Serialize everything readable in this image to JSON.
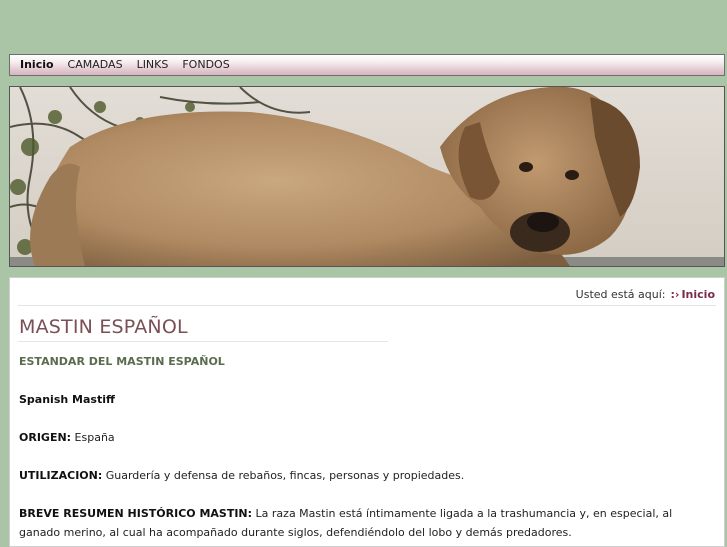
{
  "nav": {
    "items": [
      {
        "label": "Inicio",
        "active": true
      },
      {
        "label": "CAMADAS",
        "active": false
      },
      {
        "label": "LINKS",
        "active": false
      },
      {
        "label": "FONDOS",
        "active": false
      }
    ]
  },
  "banner": {
    "icon": "mastiff-puppy-photo"
  },
  "breadcrumb": {
    "prefix": "Usted está aquí:",
    "separator": ":›",
    "current": "Inicio"
  },
  "page": {
    "title": "MASTIN ESPAÑOL",
    "subtitle": "ESTANDAR DEL MASTIN ESPAÑOL",
    "breed_name": "Spanish Mastiff",
    "origin_label": "ORIGEN:",
    "origin_text": " España",
    "use_label": "UTILIZACION:",
    "use_text": " Guardería y defensa de rebaños, fincas, personas y propiedades.",
    "history_label": "BREVE RESUMEN HISTÓRICO MASTIN:",
    "history_text": " La raza Mastin está íntimamente ligada a la trashumancia y, en especial, al ganado merino, al cual ha acompañado durante siglos, defendiéndolo del lobo y demás predadores."
  },
  "colors": {
    "background": "#aac5a5",
    "nav_gradient_end": "#d7b5bf",
    "title": "#7a4f55",
    "subtitle": "#5a6b4e",
    "breadcrumb_link": "#7a2b4b"
  }
}
